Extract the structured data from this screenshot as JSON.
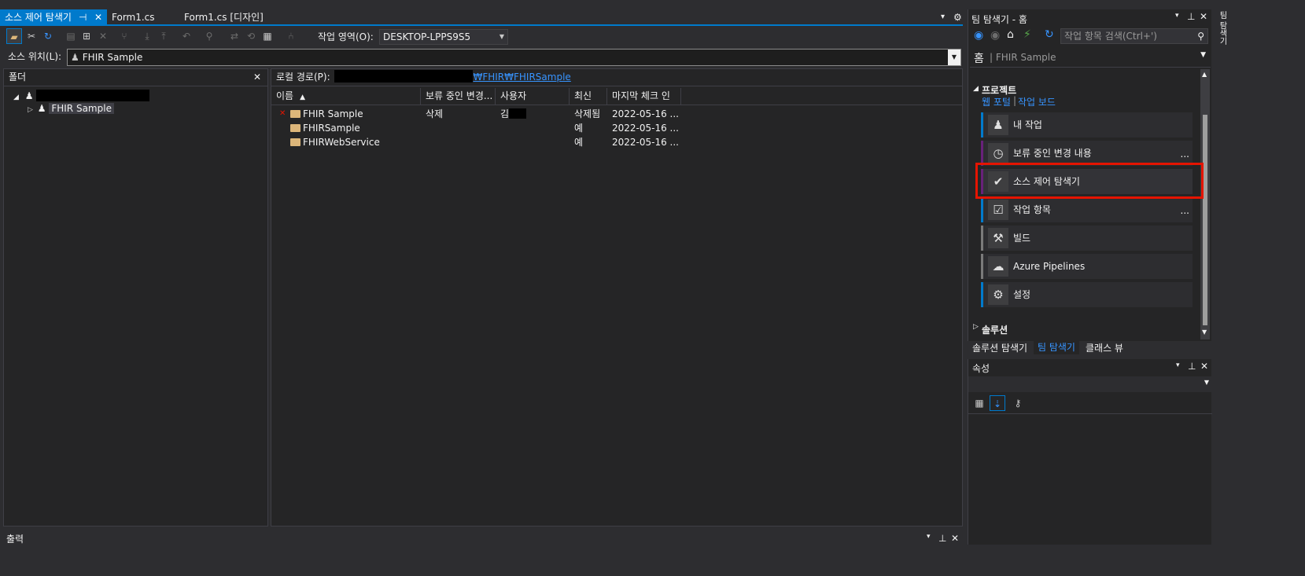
{
  "tabs": [
    {
      "label": "소스 제어 탐색기",
      "pin": "⊣",
      "close": "✕"
    },
    {
      "label": "Form1.cs"
    },
    {
      "label": "Form1.cs [디자인]"
    }
  ],
  "tabbar_menu": "▾",
  "tabbar_gear": "⚙",
  "toolbar": {
    "workspace_label": "작업 영역(O):",
    "workspace_value": "DESKTOP-LPPS9S5"
  },
  "source_location": {
    "label": "소스 위치(L):",
    "value": "FHIR Sample"
  },
  "folders": {
    "title": "폴더",
    "close": "✕",
    "tree": [
      {
        "label": ""
      },
      {
        "label": "FHIR Sample"
      }
    ]
  },
  "local_path": {
    "label": "로컬 경로(P):",
    "value": "₩FHIR₩FHIRSample"
  },
  "file_list": {
    "columns": [
      "이름",
      "보류 중인 변경...",
      "사용자",
      "최신",
      "마지막 체크 인"
    ],
    "sort_indicator": "▲",
    "rows": [
      {
        "name": "FHIR Sample",
        "pending": "삭제",
        "user": "김",
        "latest": "삭제됨",
        "checkin": "2022-05-16 ...",
        "deleted_mark": "✕"
      },
      {
        "name": "FHIRSample",
        "pending": "",
        "user": "",
        "latest": "예",
        "checkin": "2022-05-16 ..."
      },
      {
        "name": "FHIRWebService",
        "pending": "",
        "user": "",
        "latest": "예",
        "checkin": "2022-05-16 ..."
      }
    ]
  },
  "team_explorer": {
    "title": "팀 탐색기 - 홈",
    "search_placeholder": "작업 항목 검색(Ctrl+')",
    "home_label": "홈",
    "home_sub": "FHIR Sample",
    "section_project": "프로젝트",
    "web_portal": "웹 포털",
    "separator": "|",
    "task_board": "작업 보드",
    "items": [
      {
        "label": "내 작업",
        "icon": "person-icon",
        "color": "#007acc"
      },
      {
        "label": "보류 중인 변경 내용",
        "icon": "clock-icon",
        "color": "#68217a"
      },
      {
        "label": "소스 제어 탐색기",
        "icon": "folder-check-icon",
        "color": "#68217a"
      },
      {
        "label": "작업 항목",
        "icon": "clipboard-icon",
        "color": "#007acc"
      },
      {
        "label": "빌드",
        "icon": "build-icon",
        "color": "#7a7a7a"
      },
      {
        "label": "Azure Pipelines",
        "icon": "cloud-icon",
        "color": "#7a7a7a"
      },
      {
        "label": "설정",
        "icon": "gear-icon",
        "color": "#007acc"
      }
    ],
    "ellipsis": "...",
    "section_solution": "솔루션",
    "bottom_tabs": [
      "솔루션 탐색기",
      "팀 탐색기",
      "클래스 뷰"
    ]
  },
  "properties": {
    "title": "속성"
  },
  "output": {
    "title": "출력"
  },
  "right_strip": "팀 탐색기",
  "highlight_color": "#e51400"
}
